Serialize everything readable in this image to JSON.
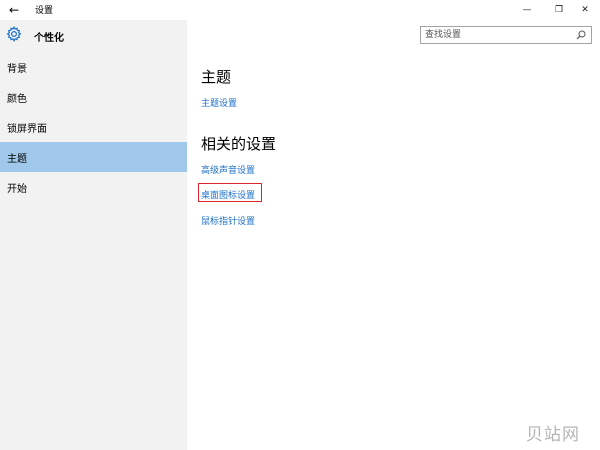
{
  "window": {
    "title": "设置",
    "back_glyph": "←",
    "min_glyph": "—",
    "max_glyph": "❐",
    "close_glyph": "✕"
  },
  "sidebar": {
    "title": "个性化",
    "items": [
      {
        "label": "背景",
        "selected": false
      },
      {
        "label": "颜色",
        "selected": false
      },
      {
        "label": "锁屏界面",
        "selected": false
      },
      {
        "label": "主题",
        "selected": true
      },
      {
        "label": "开始",
        "selected": false
      }
    ]
  },
  "search": {
    "placeholder": "查找设置"
  },
  "main": {
    "section1_title": "主题",
    "theme_settings_link": "主题设置",
    "section2_title": "相关的设置",
    "links": [
      "高级声音设置",
      "桌面图标设置",
      "鼠标指针设置"
    ]
  },
  "watermark": "贝站网",
  "colors": {
    "accent": "#1e70c8",
    "selected_bg": "#9fc8ea",
    "highlight": "#d9262b"
  }
}
